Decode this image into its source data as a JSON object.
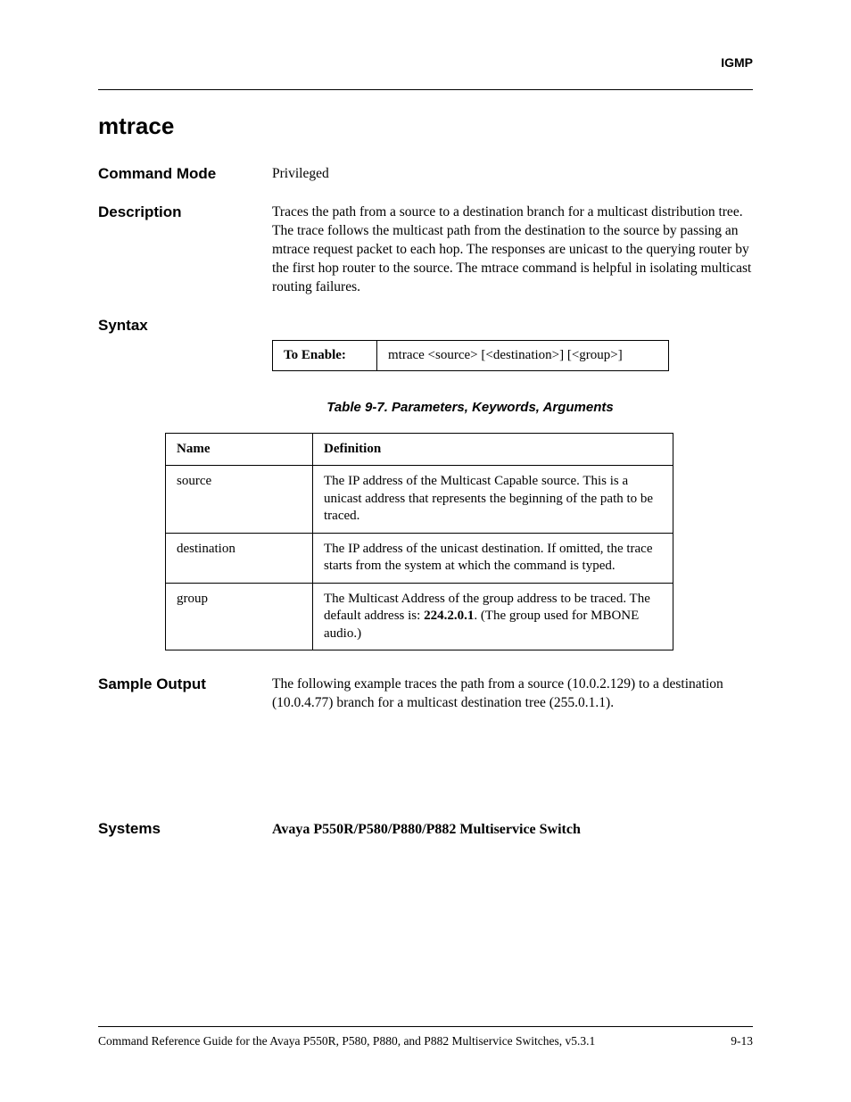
{
  "header": {
    "section_label": "IGMP"
  },
  "title": "mtrace",
  "command_mode": {
    "label": "Command Mode",
    "value": "Privileged"
  },
  "description": {
    "label": "Description",
    "text": "Traces the path from a source to a destination branch for a multicast distribution tree. The trace follows the multicast path from the destination to the source by passing an mtrace request packet to each hop. The responses are unicast to the querying router by the first hop router to the source. The mtrace command is helpful in isolating multicast routing failures."
  },
  "syntax": {
    "label": "Syntax",
    "enable_label": "To Enable:",
    "enable_value": "mtrace <source> [<destination>] [<group>]"
  },
  "params_table": {
    "caption": "Table 9-7.  Parameters, Keywords, Arguments",
    "headers": {
      "name": "Name",
      "definition": "Definition"
    },
    "rows": [
      {
        "name": "source",
        "def": "The IP address of the Multicast Capable source. This is a unicast address that represents the beginning of the path to be traced."
      },
      {
        "name": "destination",
        "def": "The IP address of the unicast destination. If omitted, the trace starts from the system at which the command is typed."
      },
      {
        "name": "group",
        "def_pre": "The Multicast Address of the group address to be traced. The default address is: ",
        "def_bold": "224.2.0.1",
        "def_post": ". (The group used for MBONE audio.)"
      }
    ]
  },
  "sample_output": {
    "label": "Sample Output",
    "text": "The following example traces the path from a source (10.0.2.129) to a destination (10.0.4.77) branch for a multicast destination tree (255.0.1.1)."
  },
  "systems": {
    "label": "Systems",
    "value": "Avaya P550R/P580/P880/P882 Multiservice Switch"
  },
  "footer": {
    "doc": "Command Reference Guide for the Avaya P550R, P580, P880, and P882 Multiservice Switches, v5.3.1",
    "page": "9-13"
  }
}
